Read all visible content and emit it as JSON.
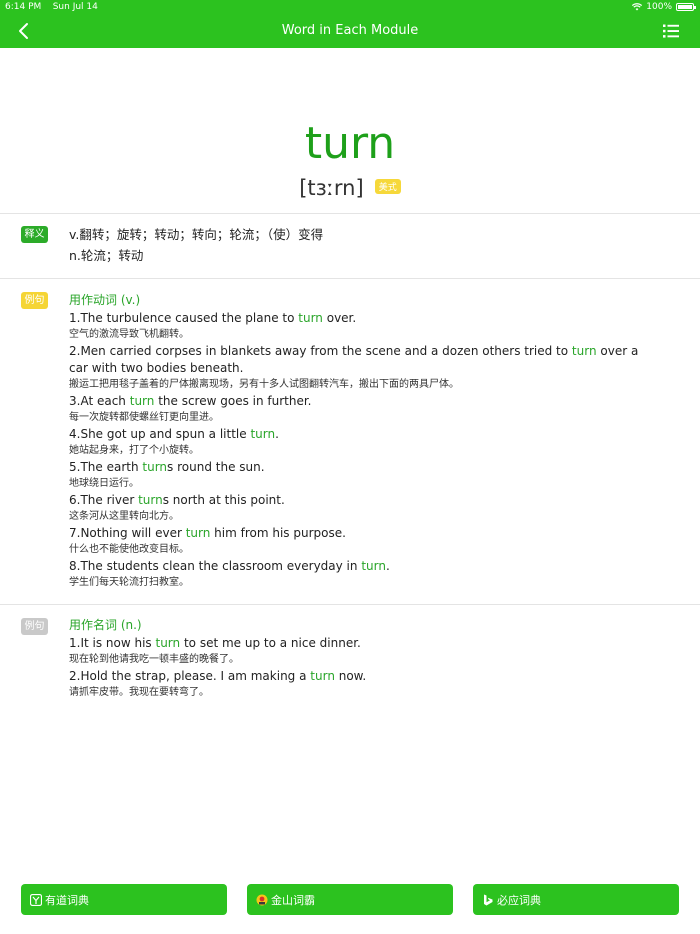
{
  "status": {
    "time": "6:14 PM",
    "date": "Sun Jul 14",
    "battery": "100%"
  },
  "nav": {
    "title": "Word in Each Module"
  },
  "word": {
    "headword": "turn",
    "phonetic": "[tɜːrn]",
    "accent_label": "美式"
  },
  "definitions": {
    "tag": "释义",
    "lines": [
      "v.翻转；旋转；转动；转向；轮流；（使）变得",
      "n.轮流；转动"
    ]
  },
  "verb_examples": {
    "tag": "例句",
    "title": "用作动词 (v.)",
    "items": [
      {
        "en_parts": [
          "1.The turbulence caused the plane to ",
          "turn",
          " over."
        ],
        "zh": "空气的激流导致飞机翻转。"
      },
      {
        "en_parts": [
          "2.Men carried corpses in blankets away from the scene and a dozen others tried to ",
          "turn",
          " over a car with two bodies beneath."
        ],
        "zh": "搬运工把用毯子盖着的尸体搬离现场，另有十多人试图翻转汽车，搬出下面的两具尸体。"
      },
      {
        "en_parts": [
          "3.At each ",
          "turn",
          " the screw goes in further."
        ],
        "zh": "每一次旋转都使螺丝钉更向里进。"
      },
      {
        "en_parts": [
          "4.She got up and spun a little ",
          "turn",
          "."
        ],
        "zh": "她站起身来，打了个小旋转。"
      },
      {
        "en_parts": [
          "5.The earth ",
          "turn",
          "s round the sun."
        ],
        "zh": "地球绕日运行。"
      },
      {
        "en_parts": [
          "6.The river ",
          "turn",
          "s north at this point."
        ],
        "zh": "这条河从这里转向北方。"
      },
      {
        "en_parts": [
          "7.Nothing will ever ",
          "turn",
          " him from his purpose."
        ],
        "zh": "什么也不能使他改变目标。"
      },
      {
        "en_parts": [
          "8.The students clean the classroom everyday in ",
          "turn",
          "."
        ],
        "zh": "学生们每天轮流打扫教室。"
      }
    ]
  },
  "noun_examples": {
    "tag": "例句",
    "title": "用作名词 (n.)",
    "items": [
      {
        "en_parts": [
          "1.It is now his ",
          "turn",
          " to set me up to a nice dinner."
        ],
        "zh": "现在轮到他请我吃一顿丰盛的晚餐了。"
      },
      {
        "en_parts": [
          "2.Hold the strap, please. I am making a ",
          "turn",
          " now."
        ],
        "zh": "请抓牢皮带。我现在要转弯了。"
      }
    ]
  },
  "dictionaries": [
    {
      "label": "有道词典",
      "icon": "youdao-icon"
    },
    {
      "label": "金山词霸",
      "icon": "kingsoft-icon"
    },
    {
      "label": "必应词典",
      "icon": "bing-icon"
    }
  ],
  "colors": {
    "brand_green": "#2cc21f",
    "highlight_green": "#2aa52a",
    "tag_yellow": "#f5d535",
    "tag_gray": "#c9c9c9"
  }
}
